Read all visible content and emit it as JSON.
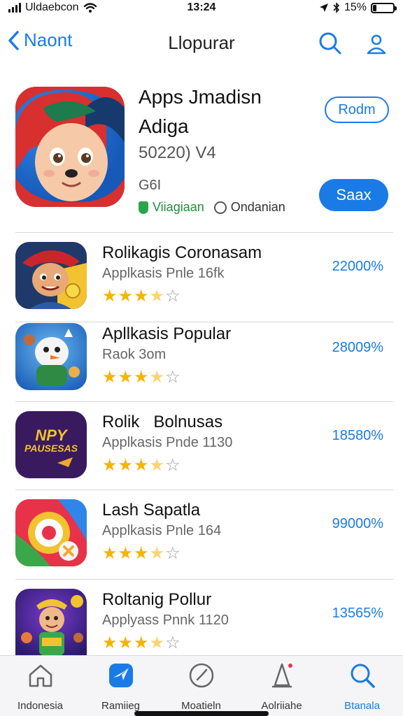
{
  "status_bar": {
    "carrier": "Uldaebcon",
    "time": "13:24",
    "battery": "15%",
    "battery_level": 0.15
  },
  "nav": {
    "back_label": "Naont",
    "title": "Llopurar",
    "icons": [
      "search-icon",
      "profile-icon"
    ]
  },
  "featured": {
    "title_line1": "Apps Jmadisn",
    "title_line2": "Adiga",
    "meta": "50220) V4",
    "rating": "G6I",
    "verified_label": "Viiagiaan",
    "option_label": "Ondanian",
    "secondary_button": "Rodm",
    "primary_button": "Saax",
    "accent_color": "#1a7be6"
  },
  "apps": [
    {
      "name": "Rolikagis Coronasam",
      "subtitle": "Applkasis Pnle 16fk",
      "percent": "22000%",
      "rating": 3.5
    },
    {
      "name": "Apllkasis Popular",
      "subtitle": "Raok 3om",
      "percent": "28009%",
      "rating": 3.5
    },
    {
      "name": "Rolik   Bolnusas",
      "subtitle": "Applkasis Pnde 1130",
      "percent": "18580%",
      "rating": 3.5,
      "icon_text_1": "NPY",
      "icon_text_2": "PAUSESAS"
    },
    {
      "name": "Lash Sapatla",
      "subtitle": "Applkasis Pnle 164",
      "percent": "99000%",
      "rating": 3.5
    },
    {
      "name": "Roltanig Pollur",
      "subtitle": "Applyass Pnnk 1120",
      "percent": "13565%",
      "rating": 3.5
    }
  ],
  "tabs": [
    {
      "label": "Indonesia",
      "icon": "home-icon"
    },
    {
      "label": "Ramiieg",
      "icon": "compass-icon"
    },
    {
      "label": "Moatieln",
      "icon": "clock-icon"
    },
    {
      "label": "Aolriiahe",
      "icon": "rocket-icon"
    },
    {
      "label": "Btanala",
      "icon": "search-icon"
    }
  ]
}
